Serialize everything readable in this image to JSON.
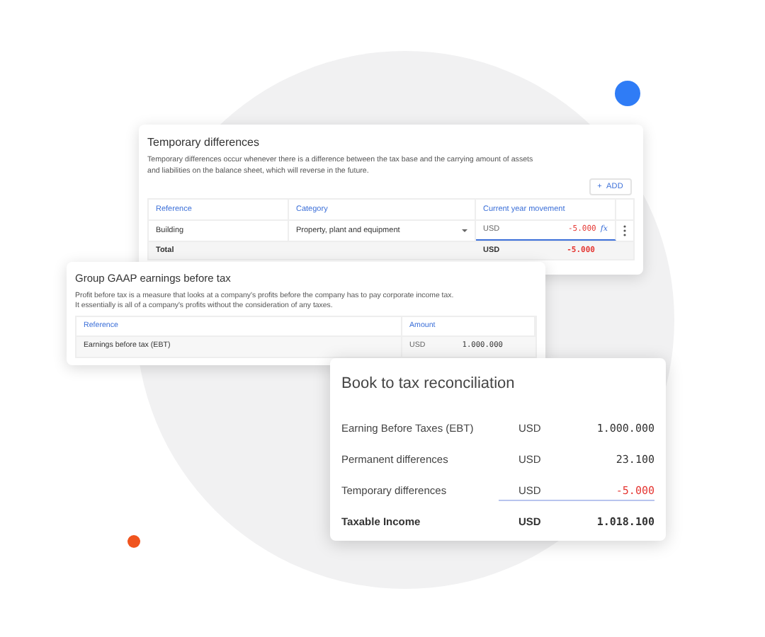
{
  "temporary_differences": {
    "title": "Temporary differences",
    "description": "Temporary differences occur whenever there is a difference between the tax base and the carrying amount of assets and liabilities on the balance sheet, which will reverse in the future.",
    "add_button": {
      "icon": "+",
      "label": "ADD"
    },
    "columns": [
      "Reference",
      "Category",
      "Current year movement"
    ],
    "row": {
      "reference": "Building",
      "category": "Property, plant and equipment",
      "currency": "USD",
      "amount": "-5.000",
      "negative": true,
      "formula": "fx"
    },
    "total": {
      "label": "Total",
      "currency": "USD",
      "amount": "-5.000",
      "negative": true
    }
  },
  "group_gaap": {
    "title": "Group GAAP earnings before tax",
    "description": [
      "Profit before tax is a measure that looks at a company's profits before the company has to pay corporate income tax.",
      "It essentially is all of a company's profits without the consideration of any taxes."
    ],
    "columns": [
      "Reference",
      "Amount"
    ],
    "row": {
      "reference": "Earnings before tax (EBT)",
      "currency": "USD",
      "amount": "1.000.000",
      "negative": false
    }
  },
  "reconciliation": {
    "title": "Book to tax reconciliation",
    "rows": [
      {
        "label": "Earning Before Taxes (EBT)",
        "currency": "USD",
        "amount": "1.000.000",
        "negative": false,
        "kind": "line"
      },
      {
        "label": "Permanent differences",
        "currency": "USD",
        "amount": "23.100",
        "negative": false,
        "kind": "line"
      },
      {
        "label": "Temporary differences",
        "currency": "USD",
        "amount": "-5.000",
        "negative": true,
        "kind": "line"
      },
      {
        "label": "Taxable Income",
        "currency": "USD",
        "amount": "1.018.100",
        "negative": false,
        "kind": "total"
      }
    ]
  }
}
